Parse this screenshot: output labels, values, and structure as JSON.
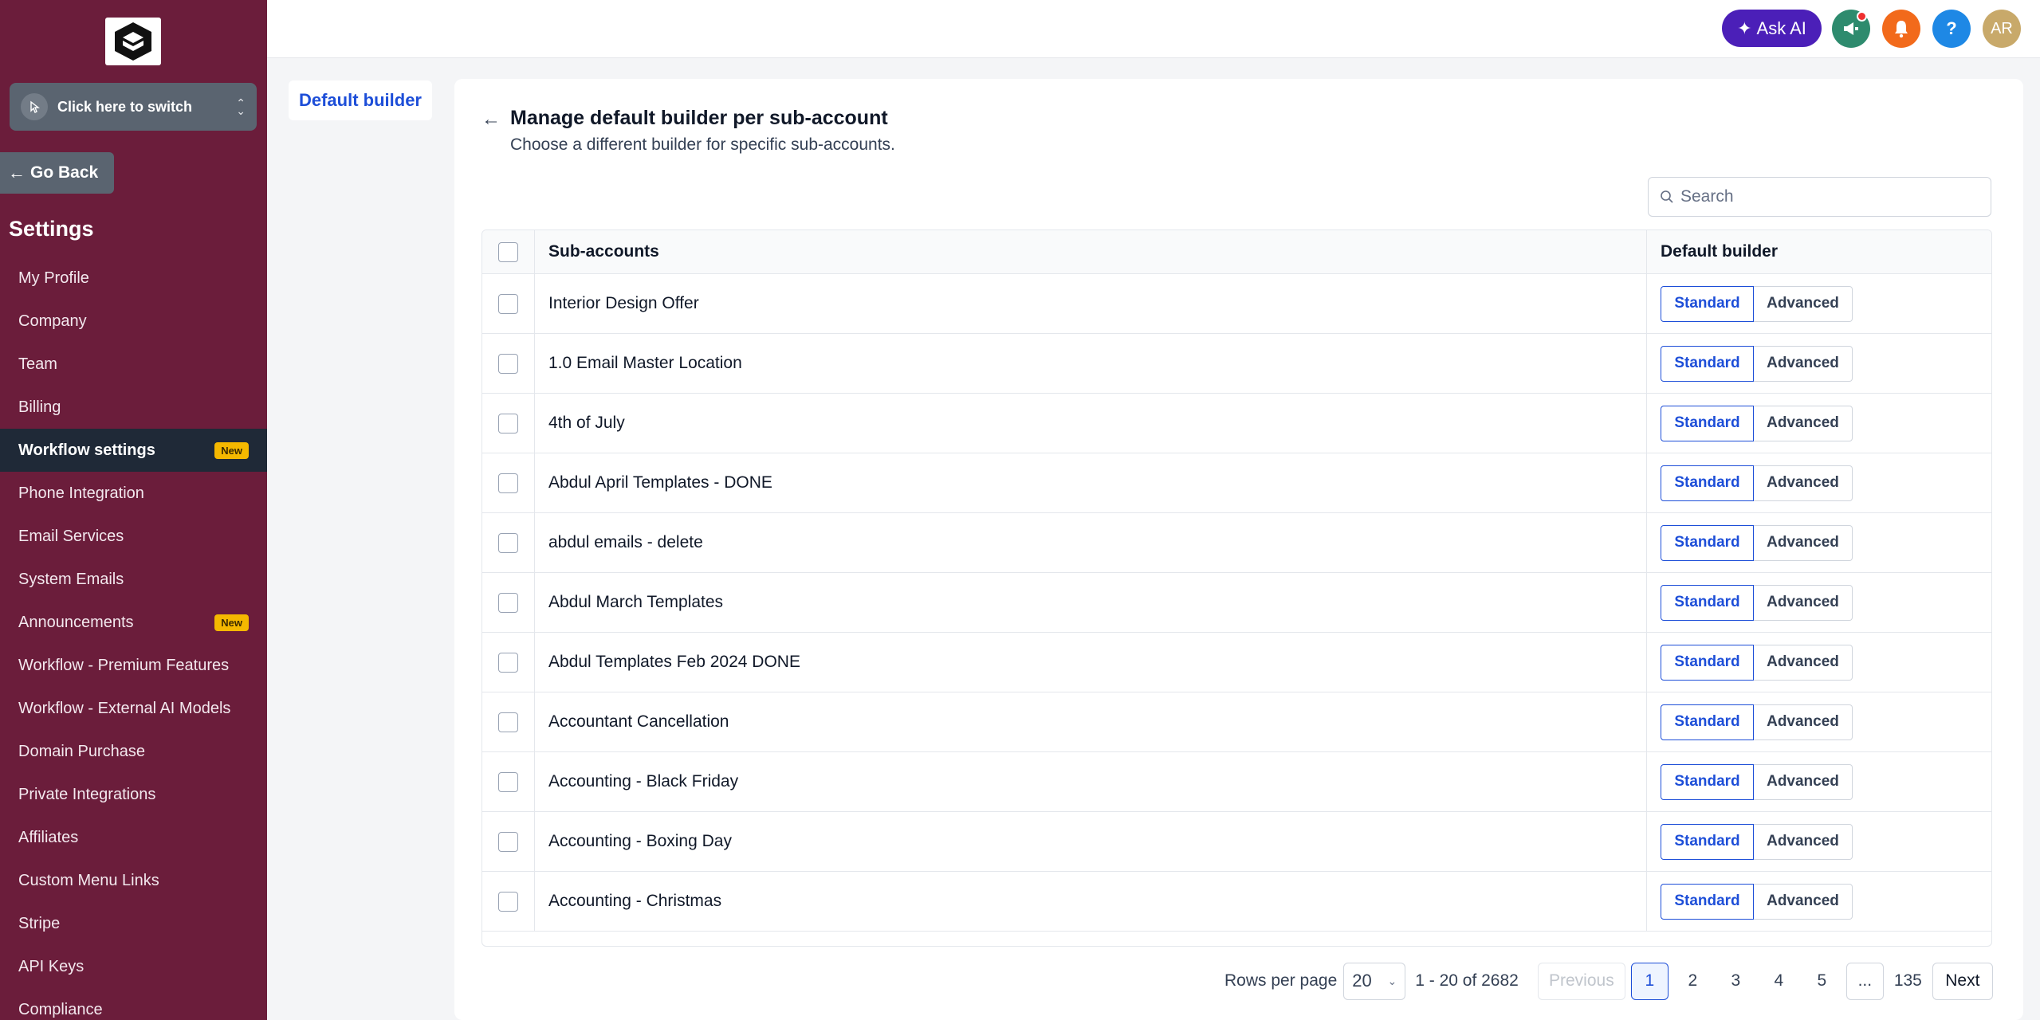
{
  "sidebar": {
    "switcher_label": "Click here to switch",
    "go_back_label": "Go Back",
    "settings_title": "Settings",
    "items": [
      {
        "label": "My Profile",
        "active": false,
        "badge": ""
      },
      {
        "label": "Company",
        "active": false,
        "badge": ""
      },
      {
        "label": "Team",
        "active": false,
        "badge": ""
      },
      {
        "label": "Billing",
        "active": false,
        "badge": ""
      },
      {
        "label": "Workflow settings",
        "active": true,
        "badge": "New"
      },
      {
        "label": "Phone Integration",
        "active": false,
        "badge": ""
      },
      {
        "label": "Email Services",
        "active": false,
        "badge": ""
      },
      {
        "label": "System Emails",
        "active": false,
        "badge": ""
      },
      {
        "label": "Announcements",
        "active": false,
        "badge": "New"
      },
      {
        "label": "Workflow - Premium Features",
        "active": false,
        "badge": ""
      },
      {
        "label": "Workflow - External AI Models",
        "active": false,
        "badge": ""
      },
      {
        "label": "Domain Purchase",
        "active": false,
        "badge": ""
      },
      {
        "label": "Private Integrations",
        "active": false,
        "badge": ""
      },
      {
        "label": "Affiliates",
        "active": false,
        "badge": ""
      },
      {
        "label": "Custom Menu Links",
        "active": false,
        "badge": ""
      },
      {
        "label": "Stripe",
        "active": false,
        "badge": ""
      },
      {
        "label": "API Keys",
        "active": false,
        "badge": ""
      },
      {
        "label": "Compliance",
        "active": false,
        "badge": ""
      }
    ]
  },
  "topbar": {
    "ask_ai_label": "Ask AI",
    "help_label": "?",
    "avatar_initials": "AR",
    "colors": {
      "ask_ai": "#4b1fb8",
      "announce": "#2e8b6e",
      "bell": "#f26a1b",
      "help": "#1e88e5",
      "avatar": "#c8a96a"
    }
  },
  "content": {
    "tab_label": "Default builder",
    "title": "Manage default builder per sub-account",
    "subtitle": "Choose a different builder for specific sub-accounts.",
    "search_placeholder": "Search",
    "columns": {
      "name": "Sub-accounts",
      "builder": "Default builder"
    },
    "option_standard": "Standard",
    "option_advanced": "Advanced",
    "rows": [
      {
        "name": "Interior Design Offer",
        "builder": "Standard"
      },
      {
        "name": "1.0 Email Master Location",
        "builder": "Standard"
      },
      {
        "name": "4th of July",
        "builder": "Standard"
      },
      {
        "name": "Abdul April Templates - DONE",
        "builder": "Standard"
      },
      {
        "name": "abdul emails - delete",
        "builder": "Standard"
      },
      {
        "name": "Abdul March Templates",
        "builder": "Standard"
      },
      {
        "name": "Abdul Templates Feb 2024 DONE",
        "builder": "Standard"
      },
      {
        "name": "Accountant Cancellation",
        "builder": "Standard"
      },
      {
        "name": "Accounting - Black Friday",
        "builder": "Standard"
      },
      {
        "name": "Accounting - Boxing Day",
        "builder": "Standard"
      },
      {
        "name": "Accounting - Christmas",
        "builder": "Standard"
      }
    ]
  },
  "pagination": {
    "rows_per_page_label": "Rows per page",
    "rows_per_page_value": "20",
    "range_text": "1 - 20 of 2682",
    "previous_label": "Previous",
    "pages": [
      "1",
      "2",
      "3",
      "4",
      "5"
    ],
    "current_page": "1",
    "ellipsis": "...",
    "last_page": "135",
    "next_label": "Next"
  }
}
